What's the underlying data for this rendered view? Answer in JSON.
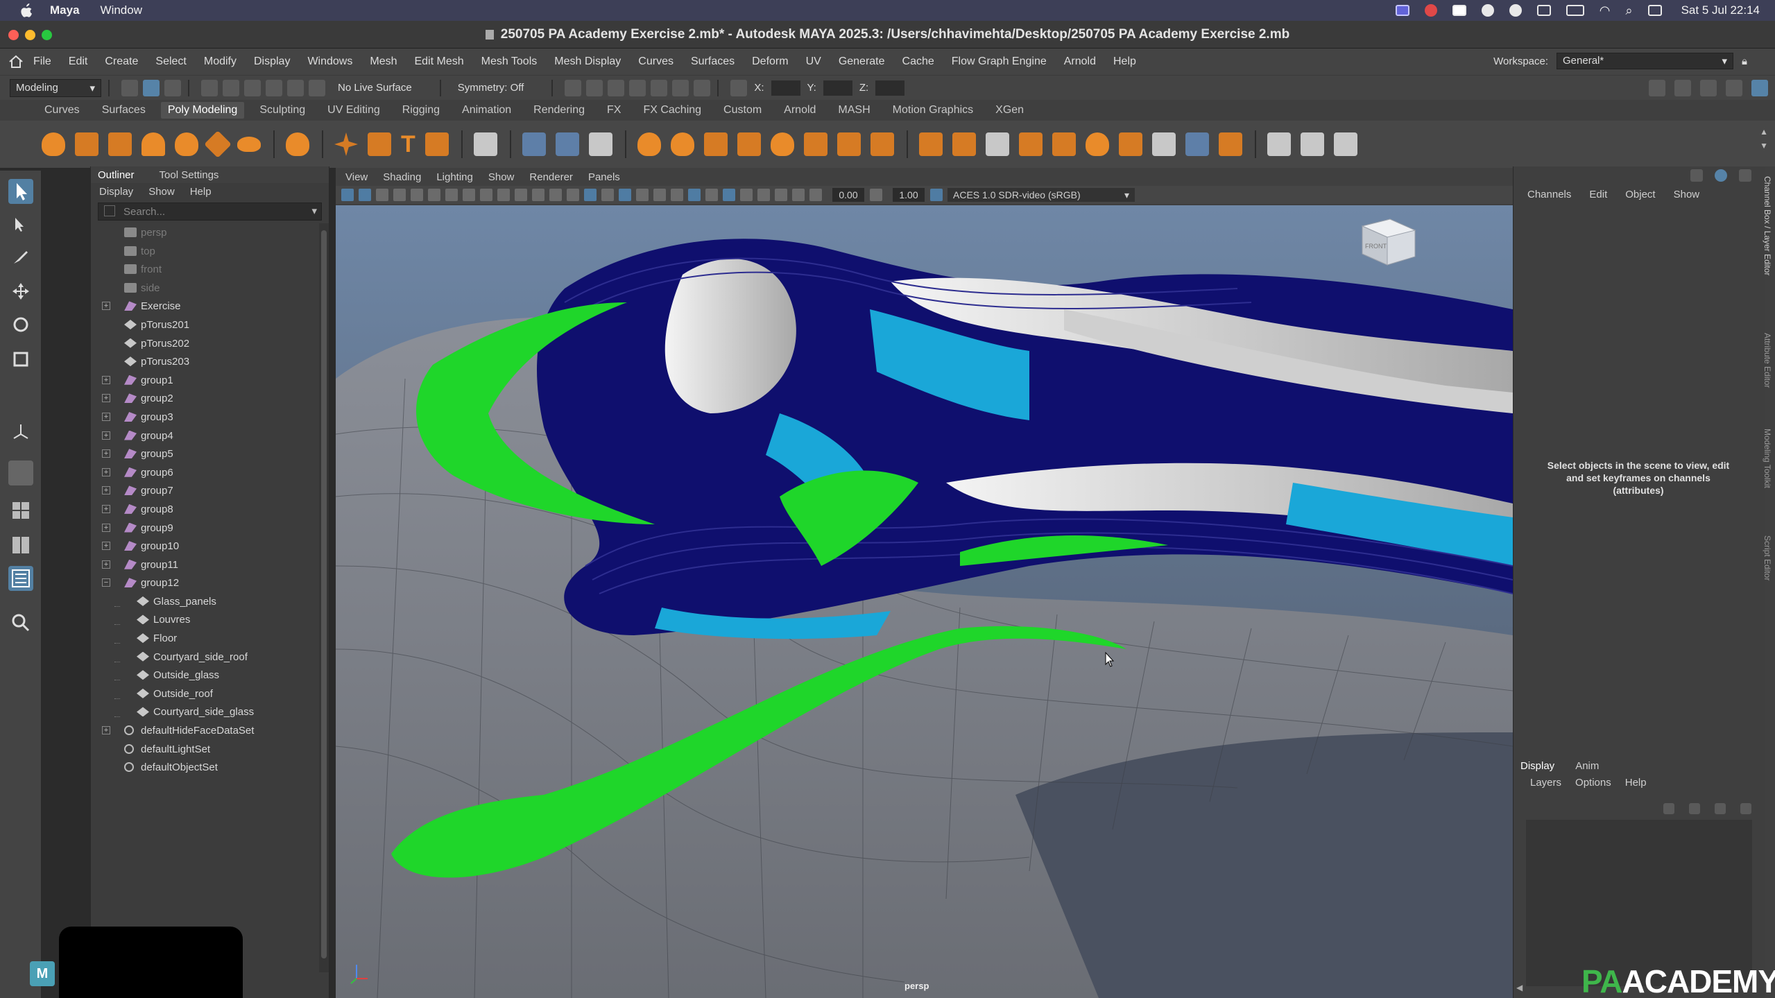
{
  "macos": {
    "menus": [
      "Maya",
      "Window"
    ],
    "clock": "Sat 5 Jul  22:14"
  },
  "window": {
    "title": "250705 PA Academy Exercise 2.mb* - Autodesk MAYA 2025.3: /Users/chhavimehta/Desktop/250705 PA Academy Exercise 2.mb"
  },
  "main_menu": [
    "File",
    "Edit",
    "Create",
    "Select",
    "Modify",
    "Display",
    "Windows",
    "Mesh",
    "Edit Mesh",
    "Mesh Tools",
    "Mesh Display",
    "Curves",
    "Surfaces",
    "Deform",
    "UV",
    "Generate",
    "Cache",
    "Flow Graph Engine",
    "Arnold",
    "Help"
  ],
  "workspace": {
    "label": "Workspace:",
    "value": "General*"
  },
  "status_line": {
    "menu_set": "Modeling",
    "live_surface": "No Live Surface",
    "symmetry": "Symmetry: Off",
    "x_label": "X:",
    "y_label": "Y:",
    "z_label": "Z:"
  },
  "shelf_tabs": [
    "Curves",
    "Surfaces",
    "Poly Modeling",
    "Sculpting",
    "UV Editing",
    "Rigging",
    "Animation",
    "Rendering",
    "FX",
    "FX Caching",
    "Custom",
    "Arnold",
    "MASH",
    "Motion Graphics",
    "XGen"
  ],
  "shelf_active": "Poly Modeling",
  "outliner": {
    "tabs": [
      "Outliner",
      "Tool Settings"
    ],
    "menu": [
      "Display",
      "Show",
      "Help"
    ],
    "search_placeholder": "Search...",
    "items": [
      {
        "label": "persp",
        "indent": 0,
        "expand": false,
        "dim": true,
        "icon": "camera"
      },
      {
        "label": "top",
        "indent": 0,
        "expand": false,
        "dim": true,
        "icon": "camera"
      },
      {
        "label": "front",
        "indent": 0,
        "expand": false,
        "dim": true,
        "icon": "camera"
      },
      {
        "label": "side",
        "indent": 0,
        "expand": false,
        "dim": true,
        "icon": "camera"
      },
      {
        "label": "Exercise",
        "indent": 0,
        "expand": "+",
        "dim": false,
        "icon": "group"
      },
      {
        "label": "pTorus201",
        "indent": 0,
        "expand": false,
        "dim": false,
        "icon": "mesh"
      },
      {
        "label": "pTorus202",
        "indent": 0,
        "expand": false,
        "dim": false,
        "icon": "mesh"
      },
      {
        "label": "pTorus203",
        "indent": 0,
        "expand": false,
        "dim": false,
        "icon": "mesh"
      },
      {
        "label": "group1",
        "indent": 0,
        "expand": "+",
        "dim": false,
        "icon": "group"
      },
      {
        "label": "group2",
        "indent": 0,
        "expand": "+",
        "dim": false,
        "icon": "group"
      },
      {
        "label": "group3",
        "indent": 0,
        "expand": "+",
        "dim": false,
        "icon": "group"
      },
      {
        "label": "group4",
        "indent": 0,
        "expand": "+",
        "dim": false,
        "icon": "group"
      },
      {
        "label": "group5",
        "indent": 0,
        "expand": "+",
        "dim": false,
        "icon": "group"
      },
      {
        "label": "group6",
        "indent": 0,
        "expand": "+",
        "dim": false,
        "icon": "group"
      },
      {
        "label": "group7",
        "indent": 0,
        "expand": "+",
        "dim": false,
        "icon": "group"
      },
      {
        "label": "group8",
        "indent": 0,
        "expand": "+",
        "dim": false,
        "icon": "group"
      },
      {
        "label": "group9",
        "indent": 0,
        "expand": "+",
        "dim": false,
        "icon": "group"
      },
      {
        "label": "group10",
        "indent": 0,
        "expand": "+",
        "dim": false,
        "icon": "group"
      },
      {
        "label": "group11",
        "indent": 0,
        "expand": "+",
        "dim": false,
        "icon": "group"
      },
      {
        "label": "group12",
        "indent": 0,
        "expand": "−",
        "dim": false,
        "icon": "group"
      },
      {
        "label": "Glass_panels",
        "indent": 1,
        "expand": false,
        "dim": false,
        "icon": "mesh"
      },
      {
        "label": "Louvres",
        "indent": 1,
        "expand": false,
        "dim": false,
        "icon": "mesh"
      },
      {
        "label": "Floor",
        "indent": 1,
        "expand": false,
        "dim": false,
        "icon": "mesh"
      },
      {
        "label": "Courtyard_side_roof",
        "indent": 1,
        "expand": false,
        "dim": false,
        "icon": "mesh"
      },
      {
        "label": "Outside_glass",
        "indent": 1,
        "expand": false,
        "dim": false,
        "icon": "mesh"
      },
      {
        "label": "Outside_roof",
        "indent": 1,
        "expand": false,
        "dim": false,
        "icon": "mesh"
      },
      {
        "label": "Courtyard_side_glass",
        "indent": 1,
        "expand": false,
        "dim": false,
        "icon": "mesh"
      },
      {
        "label": "defaultHideFaceDataSet",
        "indent": 0,
        "expand": "+",
        "dim": false,
        "icon": "set"
      },
      {
        "label": "defaultLightSet",
        "indent": 0,
        "expand": false,
        "dim": false,
        "icon": "set"
      },
      {
        "label": "defaultObjectSet",
        "indent": 0,
        "expand": false,
        "dim": false,
        "icon": "set"
      }
    ]
  },
  "viewport": {
    "menu": [
      "View",
      "Shading",
      "Lighting",
      "Show",
      "Renderer",
      "Panels"
    ],
    "exposure": "0.00",
    "gamma": "1.00",
    "color_management": "ACES 1.0 SDR-video (sRGB)",
    "camera": "persp",
    "viewcube_face": "FRONT"
  },
  "channel_box": {
    "menu": [
      "Channels",
      "Edit",
      "Object",
      "Show"
    ],
    "message": "Select objects in the scene to view, edit and set keyframes on channels (attributes)",
    "side_tabs": [
      "Channel Box / Layer Editor",
      "Attribute Editor",
      "Modeling Toolkit",
      "Script Editor"
    ]
  },
  "layer_editor": {
    "tabs": [
      "Display",
      "Anim"
    ],
    "menu": [
      "Layers",
      "Options",
      "Help"
    ]
  },
  "branding": {
    "pa": "PA",
    "academy": "ACADEMY",
    "app_badge": "M"
  },
  "colors": {
    "accent_blue": "#5683a8",
    "scene_bg_top": "#6f87a6",
    "navy": "#0f0f6e",
    "green": "#1fd62a",
    "glass": "#1aa7d8"
  }
}
